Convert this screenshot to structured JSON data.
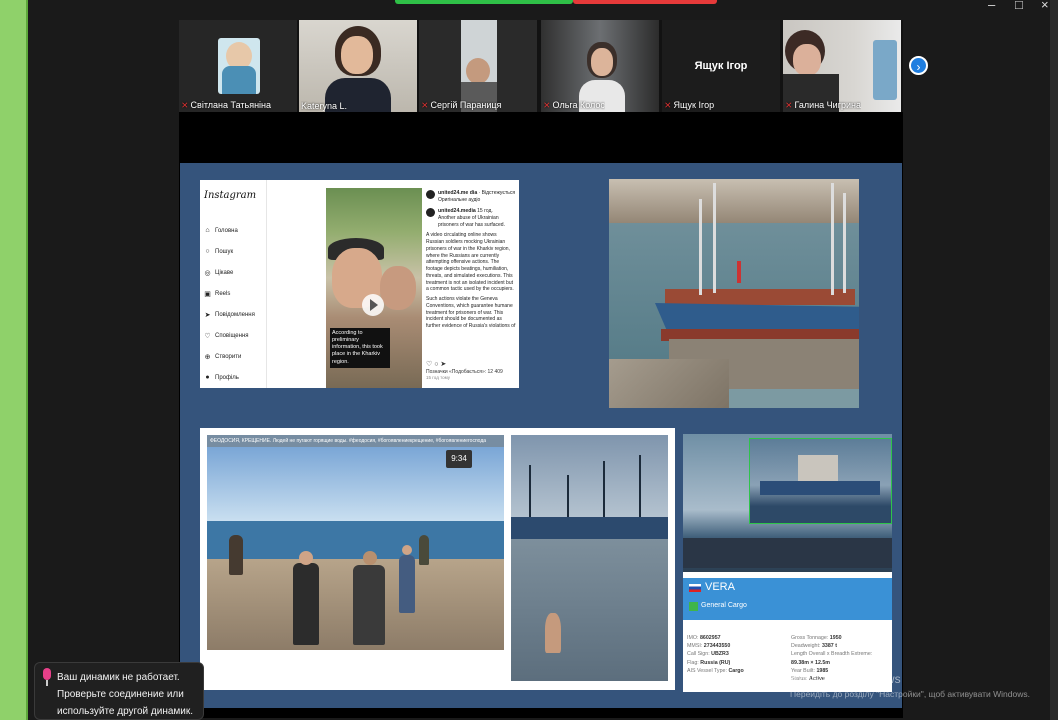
{
  "window": {
    "controls": [
      "–",
      "□",
      "×"
    ]
  },
  "participants": [
    {
      "name": "Світлана Татьяніна",
      "muted": true
    },
    {
      "name": "Kateryna L.",
      "muted": false,
      "active": true
    },
    {
      "name": "Сергій Параниця",
      "muted": true
    },
    {
      "name": "Ольга Колос",
      "muted": true
    },
    {
      "name": "Ящук Ігор",
      "muted": true,
      "label": "Ящук Ігор"
    },
    {
      "name": "Галина Чигрина",
      "muted": true
    }
  ],
  "instagram": {
    "logo": "Instagram",
    "nav": [
      "Головна",
      "Пошук",
      "Цікаве",
      "Reels",
      "Повідомлення",
      "Сповіщення",
      "Створити",
      "Профіль"
    ],
    "account": "united24.me dia",
    "follow": "· Відстежується",
    "original": "Оригінальне аудіо",
    "author": "united24.media",
    "time": "15 год.",
    "lead": "Another abuse of Ukrainian prisoners of war has surfaced.",
    "body1": "A video circulating online shows Russian soldiers mocking Ukrainian prisoners of war in the Kharkiv region, where the Russians are currently attempting offensive actions. The footage depicts beatings, humiliation, threats, and simulated executions. This treatment is not an isolated incident but a common tactic used by the occupiers.",
    "body2": "Such actions violate the Geneva Conventions, which guarantee humane treatment for prisoners of war. This incident should be documented as further evidence of Russia's violations of",
    "caption": "According to preliminary information, this took place in the Kharkiv region.",
    "likes": "Позначки «Подобається»: 12 409",
    "posted": "15 год тому"
  },
  "beach": {
    "title": "ФЕОДОСИЯ, КРЕЩЕНИЕ. Людей не пугают горящие воды. #феодосия, #богоявлениекрещение, #богоявлениегоспода",
    "timer": "9:34"
  },
  "vera": {
    "name": "VERA",
    "type": "General Cargo",
    "left": [
      {
        "label": "IMO:",
        "value": "8602957"
      },
      {
        "label": "MMSI:",
        "value": "273443550"
      },
      {
        "label": "Call Sign:",
        "value": "UBZR3"
      },
      {
        "label": "Flag:",
        "value": "Russia (RU)"
      },
      {
        "label": "AIS Vessel Type:",
        "value": "Cargo"
      }
    ],
    "right": [
      {
        "label": "Gross Tonnage:",
        "value": "1950"
      },
      {
        "label": "Deadweight:",
        "value": "3387 t"
      },
      {
        "label": "Length Overall x Breadth Extreme:",
        "value": ""
      },
      {
        "label": "",
        "value": "89.38m × 12.5m"
      },
      {
        "label": "Year Built:",
        "value": "1985"
      },
      {
        "label": "Status:",
        "value": "Active"
      }
    ]
  },
  "watermark": {
    "line1": "Активация Windows",
    "line2": "Перейдіть до розділу \"Настройки\", щоб активувати Windows."
  },
  "toast": {
    "text": "Ваш динамик не работает. Проверьте соединение или используйте другой динамик."
  },
  "colors": {
    "accent_green": "#27c44d",
    "slide_bg": "#35547c",
    "next_button": "#1f7ee0"
  }
}
